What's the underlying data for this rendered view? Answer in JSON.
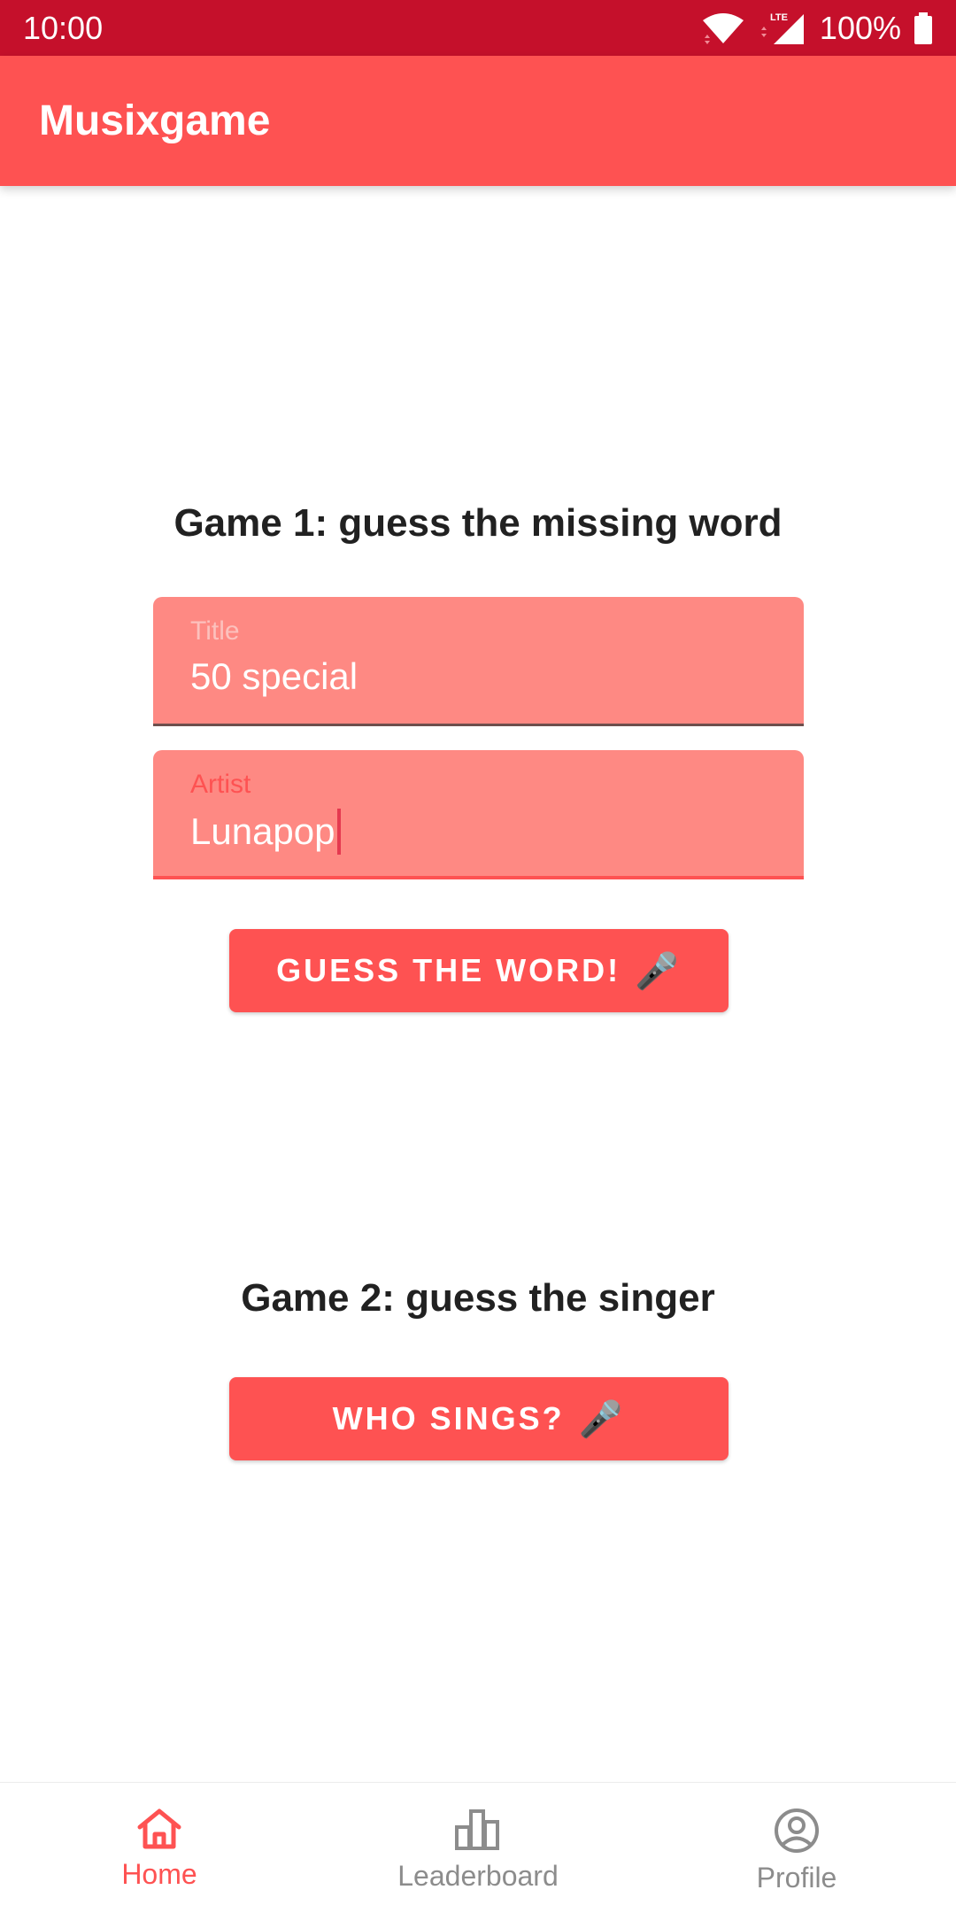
{
  "status_bar": {
    "time": "10:00",
    "battery": "100%",
    "network": "LTE"
  },
  "app_bar": {
    "title": "Musixgame"
  },
  "game1": {
    "title": "Game 1: guess the missing word",
    "title_field": {
      "label": "Title",
      "value": "50 special"
    },
    "artist_field": {
      "label": "Artist",
      "value": "Lunapop"
    },
    "button_label": "GUESS THE WORD!",
    "button_icon": "microphone-icon"
  },
  "game2": {
    "title": "Game 2: guess the singer",
    "button_label": "WHO SINGS?",
    "button_icon": "microphone-icon"
  },
  "bottom_nav": {
    "items": [
      {
        "label": "Home",
        "icon": "home-icon",
        "active": true
      },
      {
        "label": "Leaderboard",
        "icon": "leaderboard-icon",
        "active": false
      },
      {
        "label": "Profile",
        "icon": "profile-icon",
        "active": false
      }
    ]
  },
  "colors": {
    "status_bar": "#c5102b",
    "primary": "#fe5252",
    "field_bg": "#fe8983",
    "inactive": "#8c8c8c"
  }
}
